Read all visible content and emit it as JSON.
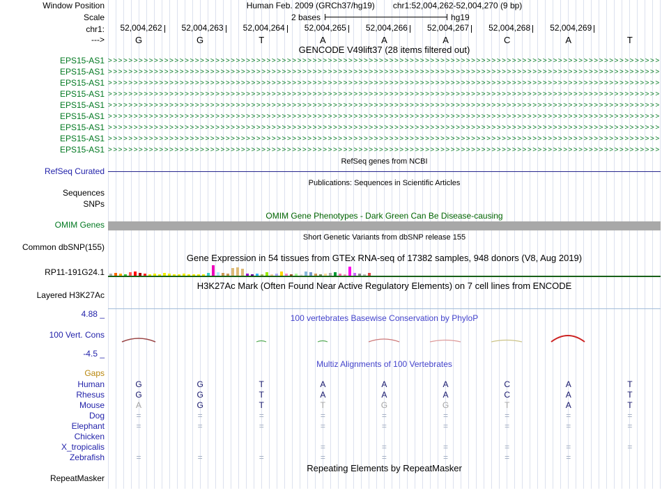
{
  "colors": {
    "grid_line": "#dce1ee",
    "gene_green": "#007820",
    "label_blue": "#2222aa",
    "title_blue": "#4444cc",
    "omim_green": "#006400",
    "gaps_orange": "#b8860b",
    "dim_gray": "#a3a3a3",
    "eq_gray": "#9aa7bd",
    "base_dark": "#16166b",
    "refseq_line": "#26268c",
    "omim_bar": "#a8a8a8",
    "gtex_baseline": "#186018",
    "h3k_line": "#a3bcd9"
  },
  "glyphs": {
    "transcript_arrow": ">"
  },
  "sidebar": {
    "window_position": "Window Position",
    "scale": "Scale"
  },
  "header": {
    "assembly": "Human Feb. 2009 (GRCh37/hg19)",
    "position": "chr1:52,004,262-52,004,270 (9 bp)",
    "scale_label": "2 bases",
    "scale_genome": "hg19",
    "chrom": "chr1:",
    "strand": "--->",
    "ruler_positions": [
      "52,004,262",
      "52,004,263",
      "52,004,264",
      "52,004,265",
      "52,004,266",
      "52,004,267",
      "52,004,268",
      "52,004,269"
    ],
    "bases": [
      "G",
      "G",
      "T",
      "A",
      "A",
      "A",
      "C",
      "A",
      "T"
    ]
  },
  "tracks": {
    "gencode": {
      "title": "GENCODE V49lift37 (28 items filtered out)",
      "items": [
        "EPS15-AS1",
        "EPS15-AS1",
        "EPS15-AS1",
        "EPS15-AS1",
        "EPS15-AS1",
        "EPS15-AS1",
        "EPS15-AS1",
        "EPS15-AS1",
        "EPS15-AS1"
      ]
    },
    "refseq": {
      "title": "RefSeq genes from NCBI",
      "label": "RefSeq Curated"
    },
    "publications": {
      "title": "Publications: Sequences in Scientific Articles",
      "sequences_label": "Sequences",
      "snps_label": "SNPs"
    },
    "omim": {
      "title": "OMIM Gene Phenotypes - Dark Green Can Be Disease-causing",
      "label": "OMIM Genes"
    },
    "dbsnp": {
      "title": "Short Genetic Variants from dbSNP release 155",
      "label": "Common dbSNP(155)"
    },
    "gtex": {
      "title": "Gene Expression in 54 tissues from GTEx RNA-seq of 17382 samples, 948 donors (V8, Aug 2019)",
      "label": "RP11-191G24.1",
      "bars": [
        [
          3,
          "#b0b0b0"
        ],
        [
          4,
          "#ff6600"
        ],
        [
          3,
          "#ffaa00"
        ],
        [
          2,
          "#33cc33"
        ],
        [
          5,
          "#ff5555"
        ],
        [
          6,
          "#ff0000"
        ],
        [
          4,
          "#aa0000"
        ],
        [
          3,
          "#ff2222"
        ],
        [
          2,
          "#eeee00"
        ],
        [
          3,
          "#eeee00"
        ],
        [
          2,
          "#eeee00"
        ],
        [
          4,
          "#eeee00"
        ],
        [
          3,
          "#eeee00"
        ],
        [
          2,
          "#eeee00"
        ],
        [
          2,
          "#eeee00"
        ],
        [
          3,
          "#eeee00"
        ],
        [
          2,
          "#eeee00"
        ],
        [
          2,
          "#eeee00"
        ],
        [
          2,
          "#eeee00"
        ],
        [
          2,
          "#eeee00"
        ],
        [
          4,
          "#33cccc"
        ],
        [
          15,
          "#ee00bb"
        ],
        [
          5,
          "#aaeeff"
        ],
        [
          4,
          "#cc9955"
        ],
        [
          3,
          "#cc9955"
        ],
        [
          11,
          "#ddbb77"
        ],
        [
          12,
          "#ddbb77"
        ],
        [
          10,
          "#ddbb77"
        ],
        [
          3,
          "#9900cc"
        ],
        [
          2,
          "#660099"
        ],
        [
          3,
          "#33bbff"
        ],
        [
          2,
          "#aabb66"
        ],
        [
          5,
          "#99ee00"
        ],
        [
          2,
          "#ffcc99"
        ],
        [
          3,
          "#aaaaff"
        ],
        [
          6,
          "#ffd700"
        ],
        [
          3,
          "#ff88cc"
        ],
        [
          2,
          "#995522"
        ],
        [
          3,
          "#aaff99"
        ],
        [
          2,
          "#dddddd"
        ],
        [
          6,
          "#88bbdd"
        ],
        [
          5,
          "#7799cc"
        ],
        [
          3,
          "#cc9955"
        ],
        [
          2,
          "#778855"
        ],
        [
          3,
          "#ffdd99"
        ],
        [
          4,
          "#aaaaaa"
        ],
        [
          5,
          "#009933"
        ],
        [
          3,
          "#ff66aa"
        ],
        [
          2,
          "#ff99bb"
        ],
        [
          13,
          "#ff00ee"
        ],
        [
          4,
          "#cc66ff"
        ],
        [
          3,
          "#888888"
        ],
        [
          2,
          "#bbbbbb"
        ],
        [
          4,
          "#dd4444"
        ]
      ]
    },
    "h3k27ac": {
      "title": "H3K27Ac Mark (Often Found Near Active Regulatory Elements) on 7 cell lines from ENCODE",
      "label": "Layered H3K27Ac"
    },
    "conservation": {
      "title": "100 vertebrates Basewise Conservation by PhyloP",
      "label": "100 Vert. Cons",
      "max_label": "4.88 _",
      "min_label": "-4.5 _",
      "bumps": [
        [
          20,
          68,
          5,
          "#994444",
          1.5
        ],
        [
          213,
          227,
          1.5,
          "#55aa55",
          1.2
        ],
        [
          301,
          315,
          1.5,
          "#55aa55",
          1.2
        ],
        [
          374,
          418,
          4,
          "#cc7777",
          1.3
        ],
        [
          462,
          506,
          2.5,
          "#dd9999",
          1.2
        ],
        [
          550,
          594,
          2.5,
          "#ccc488",
          1.2
        ],
        [
          636,
          684,
          9,
          "#cc2222",
          2
        ]
      ]
    },
    "multiz": {
      "title": "Multiz Alignments of 100 Vertebrates",
      "gaps_label": "Gaps",
      "species": [
        {
          "name": "Human",
          "cells": [
            "G",
            "G",
            "T",
            "A",
            "A",
            "A",
            "C",
            "A",
            "T"
          ],
          "dim": [
            0,
            0,
            0,
            0,
            0,
            0,
            0,
            0,
            0
          ]
        },
        {
          "name": "Rhesus",
          "cells": [
            "G",
            "G",
            "T",
            "A",
            "A",
            "A",
            "C",
            "A",
            "T"
          ],
          "dim": [
            0,
            0,
            0,
            0,
            0,
            0,
            0,
            0,
            0
          ]
        },
        {
          "name": "Mouse",
          "cells": [
            "A",
            "G",
            "T",
            "T",
            "G",
            "G",
            "T",
            "A",
            "T"
          ],
          "dim": [
            1,
            0,
            0,
            1,
            1,
            1,
            1,
            0,
            0
          ]
        },
        {
          "name": "Dog",
          "cells": [
            "=",
            "=",
            "=",
            "=",
            "=",
            "=",
            "=",
            "=",
            "="
          ],
          "dim": [
            1,
            1,
            1,
            1,
            1,
            1,
            1,
            1,
            1
          ]
        },
        {
          "name": "Elephant",
          "cells": [
            "=",
            "=",
            "=",
            "=",
            "=",
            "=",
            "=",
            "=",
            "="
          ],
          "dim": [
            1,
            1,
            1,
            1,
            1,
            1,
            1,
            1,
            1
          ]
        },
        {
          "name": "Chicken",
          "cells": [
            "",
            "",
            "",
            "",
            "",
            "",
            "",
            "",
            ""
          ],
          "dim": [
            0,
            0,
            0,
            0,
            0,
            0,
            0,
            0,
            0
          ]
        },
        {
          "name": "X_tropicalis",
          "cells": [
            "",
            "",
            "",
            "=",
            "=",
            "=",
            "=",
            "=",
            "="
          ],
          "dim": [
            0,
            0,
            0,
            1,
            1,
            1,
            1,
            1,
            1
          ]
        },
        {
          "name": "Zebrafish",
          "cells": [
            "=",
            "=",
            "=",
            "=",
            "=",
            "=",
            "=",
            "=",
            ""
          ],
          "dim": [
            1,
            1,
            1,
            1,
            1,
            1,
            1,
            1,
            0
          ]
        }
      ]
    },
    "repeatmasker": {
      "title": "Repeating Elements by RepeatMasker",
      "label": "RepeatMasker"
    }
  }
}
